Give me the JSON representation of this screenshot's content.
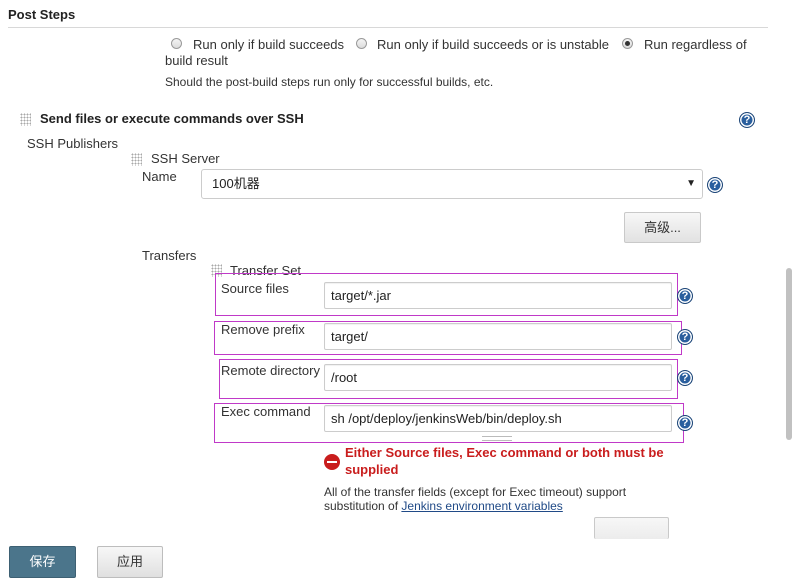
{
  "section": {
    "title": "Post Steps"
  },
  "post_build": {
    "options": [
      {
        "label": "Run only if build succeeds",
        "checked": false
      },
      {
        "label": "Run only if build succeeds or is unstable",
        "checked": false
      },
      {
        "label_line1": "Run regardless of",
        "label_line2": "build result",
        "checked": true
      }
    ],
    "description": "Should the post-build steps run only for successful builds, etc."
  },
  "ssh_step": {
    "title": "Send files or execute commands over SSH",
    "publishers_label": "SSH Publishers",
    "server_label": "SSH Server",
    "name_label": "Name",
    "name_value": "100机器",
    "advanced_label": "高级...",
    "transfers_label": "Transfers",
    "transfer_set_label": "Transfer Set"
  },
  "transfer_set": {
    "source_files_label": "Source files",
    "source_files_value": "target/*.jar",
    "remove_prefix_label": "Remove prefix",
    "remove_prefix_value": "target/",
    "remote_directory_label": "Remote directory",
    "remote_directory_value": "/root",
    "exec_command_label": "Exec command",
    "exec_command_value": "sh /opt/deploy/jenkinsWeb/bin/deploy.sh"
  },
  "validation": {
    "error_line1": "Either Source files, Exec command or both must be",
    "error_line2": "supplied",
    "info_line1": "All of the transfer fields (except for Exec timeout) support",
    "info_line2_prefix": "substitution of ",
    "info_link": "Jenkins environment variables"
  },
  "footer": {
    "save_label": "保存",
    "apply_label": "应用"
  },
  "icons": {
    "help": "help-icon",
    "error": "error-icon",
    "drag": "drag-handle-icon"
  },
  "colors": {
    "primary_button": "#4b758b",
    "error": "#c91d1d",
    "highlight": "#c039c8",
    "help": "#2a5f9e"
  }
}
